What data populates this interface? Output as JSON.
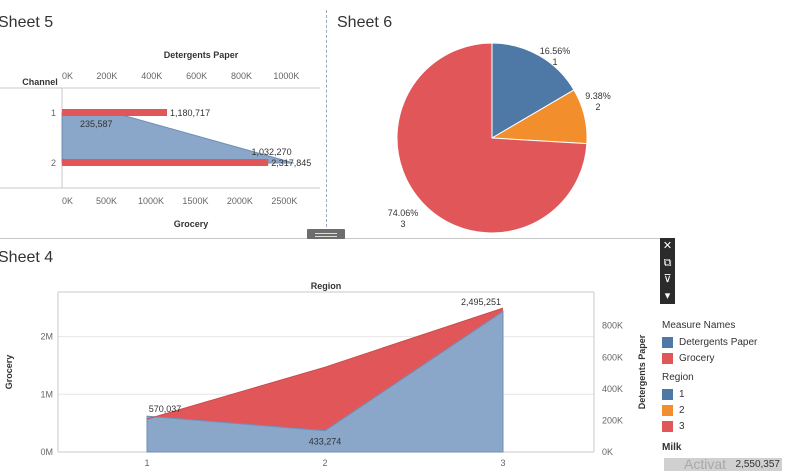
{
  "sheets": {
    "sheet5_title": "Sheet 5",
    "sheet6_title": "Sheet 6",
    "sheet4_title": "Sheet 4"
  },
  "colors": {
    "blue": "#4e79a7",
    "blue_area": "#8aa6c8",
    "red": "#e15759",
    "orange": "#f28e2b",
    "gridline": "#e6e6e6",
    "axis": "#c8c8c8"
  },
  "legend": {
    "measure_title": "Measure Names",
    "measures": [
      {
        "label": "Detergents Paper",
        "color": "#4e79a7"
      },
      {
        "label": "Grocery",
        "color": "#e15759"
      }
    ],
    "region_title": "Region",
    "regions": [
      {
        "label": "1",
        "color": "#4e79a7"
      },
      {
        "label": "2",
        "color": "#f28e2b"
      },
      {
        "label": "3",
        "color": "#e15759"
      }
    ],
    "milk_title": "Milk",
    "milk_value": "2,550,357"
  },
  "toolbar": {
    "close_icon": "close-icon",
    "popout_icon": "popout-icon",
    "filter_icon": "filter-icon",
    "menu_icon": "dropdown-icon"
  },
  "watermark": "Activat",
  "chart_data": [
    {
      "id": "sheet5",
      "type": "bar",
      "title": "Sheet 5",
      "row_header": "Channel",
      "categories": [
        "1",
        "2"
      ],
      "top_axis_title": "Detergents Paper",
      "top_axis_ticks": [
        "0K",
        "200K",
        "400K",
        "600K",
        "800K",
        "1000K"
      ],
      "top_axis_range": [
        0,
        1150000
      ],
      "bottom_axis_title": "Grocery",
      "bottom_axis_ticks": [
        "0K",
        "500K",
        "1000K",
        "1500K",
        "2000K",
        "2500K"
      ],
      "bottom_axis_range": [
        0,
        2900000
      ],
      "series": [
        {
          "name": "Detergents Paper",
          "mark": "area",
          "values": [
            235587,
            1032270
          ],
          "labels": [
            "235,587",
            "1,032,270"
          ]
        },
        {
          "name": "Grocery",
          "mark": "bar",
          "values": [
            1180717,
            2317845
          ],
          "labels": [
            "1,180,717",
            "2,317,845"
          ]
        }
      ]
    },
    {
      "id": "sheet6",
      "type": "pie",
      "title": "Sheet 6",
      "slices": [
        {
          "region": "1",
          "percent": 16.56,
          "label": "16.56%",
          "sub": "1"
        },
        {
          "region": "2",
          "percent": 9.38,
          "label": "9.38%",
          "sub": "2"
        },
        {
          "region": "3",
          "percent": 74.06,
          "label": "74.06%",
          "sub": "3"
        }
      ]
    },
    {
      "id": "sheet4",
      "type": "area",
      "title": "Sheet 4",
      "column_header": "Region",
      "x": [
        "1",
        "2",
        "3"
      ],
      "left_axis_title": "Grocery",
      "left_axis_ticks": [
        "0M",
        "1M",
        "2M"
      ],
      "left_axis_range": [
        0,
        2600000
      ],
      "right_axis_title": "Detergents Paper",
      "right_axis_ticks": [
        "0K",
        "200K",
        "400K",
        "600K",
        "800K"
      ],
      "right_axis_range": [
        0,
        950000
      ],
      "series": [
        {
          "name": "Grocery",
          "values": [
            570037,
            1470000,
            2495251
          ],
          "labels": [
            "570,037",
            "",
            "2,495,251"
          ]
        },
        {
          "name": "Detergents Paper",
          "values": [
            227000,
            135000,
            890000
          ],
          "labels": [
            "",
            "433,274",
            ""
          ]
        }
      ]
    }
  ]
}
